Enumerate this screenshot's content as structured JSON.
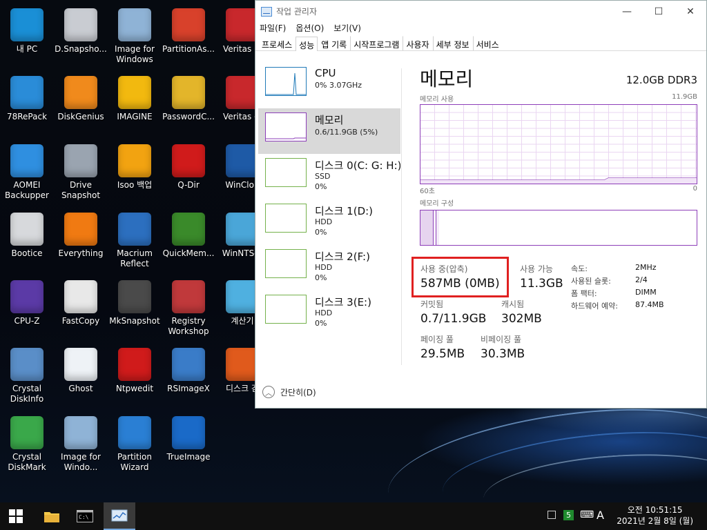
{
  "desktop": {
    "icons": [
      {
        "label": "내 PC",
        "icon": "monitor-icon",
        "color": "#1a8fd6"
      },
      {
        "label": "D.Snapsho...",
        "icon": "disk-drive-icon",
        "color": "#c9ccd2"
      },
      {
        "label": "Image for Windows",
        "icon": "pc-monitor-icon",
        "color": "#8fb3d6"
      },
      {
        "label": "PartitionAs...",
        "icon": "partition-pie-icon",
        "color": "#d8412b"
      },
      {
        "label": "Veritas 백",
        "icon": "veritas-icon",
        "color": "#c8282c"
      },
      {
        "label": "78RePack",
        "icon": "triangle-logo-icon",
        "color": "#2a8cd8"
      },
      {
        "label": "DiskGenius",
        "icon": "diskgenius-icon",
        "color": "#f08a1c"
      },
      {
        "label": "IMAGINE",
        "icon": "sunflower-icon",
        "color": "#f2b90f"
      },
      {
        "label": "PasswordC...",
        "icon": "key-icon",
        "color": "#e3b52a"
      },
      {
        "label": "Veritas 복",
        "icon": "veritas-icon",
        "color": "#c8282c"
      },
      {
        "label": "AOMEI Backupper",
        "icon": "refresh-icon",
        "color": "#2f8fe0"
      },
      {
        "label": "Drive Snapshot",
        "icon": "camera-icon",
        "color": "#9aa4b0"
      },
      {
        "label": "Isoo 백업",
        "icon": "isoo-icon",
        "color": "#f2a311"
      },
      {
        "label": "Q-Dir",
        "icon": "grid-icon",
        "color": "#d01b1b"
      },
      {
        "label": "WinClon",
        "icon": "winclon-icon",
        "color": "#1e5aa6"
      },
      {
        "label": "Bootice",
        "icon": "eraser-icon",
        "color": "#d7d9dc"
      },
      {
        "label": "Everything",
        "icon": "magnifier-icon",
        "color": "#f07a12"
      },
      {
        "label": "Macrium Reflect",
        "icon": "disk-icon",
        "color": "#2c6fbf"
      },
      {
        "label": "QuickMem...",
        "icon": "q-icon",
        "color": "#3a8a2a"
      },
      {
        "label": "WinNTSet",
        "icon": "winntsetup-icon",
        "color": "#4aa6d8"
      },
      {
        "label": "CPU-Z",
        "icon": "chip-icon",
        "color": "#5b3aa6"
      },
      {
        "label": "FastCopy",
        "icon": "fastcopy-icon",
        "color": "#e8e8e8"
      },
      {
        "label": "MkSnapshot",
        "icon": "windows-flag-icon",
        "color": "#4a4a4a"
      },
      {
        "label": "Registry Workshop",
        "icon": "cubes-icon",
        "color": "#c0393b"
      },
      {
        "label": "계산기",
        "icon": "calculator-icon",
        "color": "#4fb0e0"
      },
      {
        "label": "Crystal DiskInfo",
        "icon": "crystal-disk-icon",
        "color": "#5a8ec8"
      },
      {
        "label": "Ghost",
        "icon": "ghost-icon",
        "color": "#eef2f6"
      },
      {
        "label": "Ntpwedit",
        "icon": "nt-key-icon",
        "color": "#d01b1b"
      },
      {
        "label": "RSImageX",
        "icon": "gear-monitor-icon",
        "color": "#3a7cc8"
      },
      {
        "label": "디스크 검",
        "icon": "windows-xp-icon",
        "color": "#e05a1c"
      },
      {
        "label": "Crystal DiskMark",
        "icon": "diskmark-icon",
        "color": "#3aa84a"
      },
      {
        "label": "Image for Windo...",
        "icon": "pc-monitor-icon",
        "color": "#8fb3d6"
      },
      {
        "label": "Partition Wizard",
        "icon": "wand-icon",
        "color": "#2a7fd4"
      },
      {
        "label": "TrueImage",
        "icon": "trueimage-icon",
        "color": "#1a6ac8"
      }
    ]
  },
  "taskmgr": {
    "title": "작업 관리자",
    "window_controls": {
      "minimize": "—",
      "maximize": "☐",
      "close": "✕"
    },
    "menu": [
      "파일(F)",
      "옵션(O)",
      "보기(V)"
    ],
    "tabs": [
      "프로세스",
      "성능",
      "앱 기록",
      "시작프로그램",
      "사용자",
      "세부 정보",
      "서비스"
    ],
    "active_tab": "성능",
    "sidebar": [
      {
        "name": "CPU",
        "line1": "0% 3.07GHz",
        "line2": ""
      },
      {
        "name": "메모리",
        "line1": "0.6/11.9GB (5%)",
        "line2": ""
      },
      {
        "name": "디스크 0(C: G: H:)",
        "line1": "SSD",
        "line2": "0%"
      },
      {
        "name": "디스크 1(D:)",
        "line1": "HDD",
        "line2": "0%"
      },
      {
        "name": "디스크 2(F:)",
        "line1": "HDD",
        "line2": "0%"
      },
      {
        "name": "디스크 3(E:)",
        "line1": "HDD",
        "line2": "0%"
      }
    ],
    "detail": {
      "title": "메모리",
      "spec": "12.0GB DDR3",
      "usage_label": "메모리 사용",
      "usage_max": "11.9GB",
      "time_label": "60초",
      "time_right": "0",
      "composition_label": "메모리 구성",
      "in_use_label": "사용 중(압축)",
      "in_use_value": "587MB (0MB)",
      "available_label": "사용 가능",
      "available_value": "11.3GB",
      "committed_label": "커밋됨",
      "committed_value": "0.7/11.9GB",
      "cached_label": "캐시됨",
      "cached_value": "302MB",
      "paged_label": "페이징 풀",
      "paged_value": "29.5MB",
      "nonpaged_label": "비페이징 풀",
      "nonpaged_value": "30.3MB",
      "speed_label": "속도:",
      "speed_value": "2MHz",
      "slots_label": "사용된 슬롯:",
      "slots_value": "2/4",
      "form_label": "폼 팩터:",
      "form_value": "DIMM",
      "reserved_label": "하드웨어 예약:",
      "reserved_value": "87.4MB"
    },
    "collapse_label": "간단히(D)"
  },
  "taskbar": {
    "start_icon": "windows-start-icon",
    "tray_badge": "5",
    "tray_ime": "A",
    "clock_time": "오전 10:51:15",
    "clock_date": "2021년 2월 8일 (월)"
  }
}
